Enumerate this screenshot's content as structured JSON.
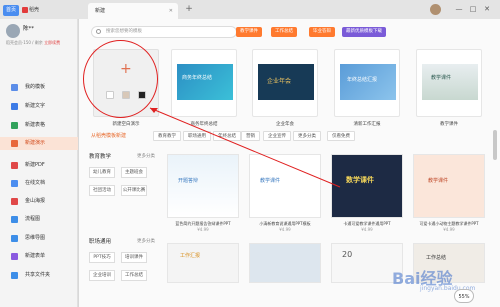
{
  "titlebar": {
    "home_tab": "首页",
    "docer_tab": "稻壳",
    "active_tab": "新建",
    "plus": "+",
    "min": "—",
    "max": "□",
    "close": "✕"
  },
  "sidebar": {
    "user_name": "陈**",
    "user_sub_prefix": "稻壳会员·150 / 剩余",
    "user_sub_link": "立即续费",
    "items": [
      {
        "label": "我的模板",
        "color": "#5b8de8"
      },
      {
        "label": "新建文字",
        "color": "#3d7be6"
      },
      {
        "label": "新建表格",
        "color": "#31a25b"
      },
      {
        "label": "新建演示",
        "color": "#e8673a"
      },
      {
        "label": "新建PDF",
        "color": "#e04848"
      },
      {
        "label": "在线文档",
        "color": "#4c8ef0"
      },
      {
        "label": "金山海报",
        "color": "#e04848"
      },
      {
        "label": "流程图",
        "color": "#3d8ee8"
      },
      {
        "label": "思维导图",
        "color": "#3d8ee8"
      },
      {
        "label": "新建表单",
        "color": "#8a5ae0"
      },
      {
        "label": "共享文件夹",
        "color": "#3d8ee8"
      }
    ]
  },
  "main": {
    "search_placeholder": "搜索您想要的模板",
    "pills": [
      "教学课件",
      "工作总结",
      "毕业答辩",
      "最新优质模板下载"
    ],
    "close": "✕",
    "top_labels": [
      "新建空白演示",
      "商务年终总结",
      "企业年会",
      "清新工作汇报",
      "教学课件"
    ],
    "thumb_texts": [
      "商务年终总结",
      "企业年会",
      "年终总结汇报",
      "教学课件"
    ],
    "section_title": "从稻壳模板新建",
    "filters": [
      "教育教学",
      "职场通用",
      "年终总结",
      "营销",
      "企业宣传",
      "更多分类",
      "仅看免费"
    ],
    "groups": [
      {
        "title": "教育教学",
        "more": "更多分类",
        "tags": [
          "幼儿教育",
          "主题班会",
          "社团活动",
          "公开课比赛"
        ]
      },
      {
        "title": "职场通用",
        "more": "更多分类",
        "tags": [
          "PPT技巧",
          "培训课件",
          "企业培训",
          "工作总结"
        ]
      }
    ],
    "cards": [
      {
        "label": "蓝色简约开题报告答辩课件PPT",
        "price": "¥4.99"
      },
      {
        "label": "小清新教育说课通用PPT模板",
        "price": "¥4.99"
      },
      {
        "label": "卡通可爱教学课件通用PPT",
        "price": "¥4.99"
      },
      {
        "label": "可爱卡通小动物主题教学课件PPT",
        "price": "¥4.99"
      }
    ],
    "card_texts": [
      "开题答辩",
      "教学课件",
      "数学课件",
      "教学课件"
    ],
    "row2_texts": [
      "工作汇报",
      "",
      "20",
      "工作总结"
    ]
  },
  "overlay": {
    "watermark": "Bai经验",
    "watermark2": "jingyan.baidu.com",
    "zoom": "55%"
  }
}
